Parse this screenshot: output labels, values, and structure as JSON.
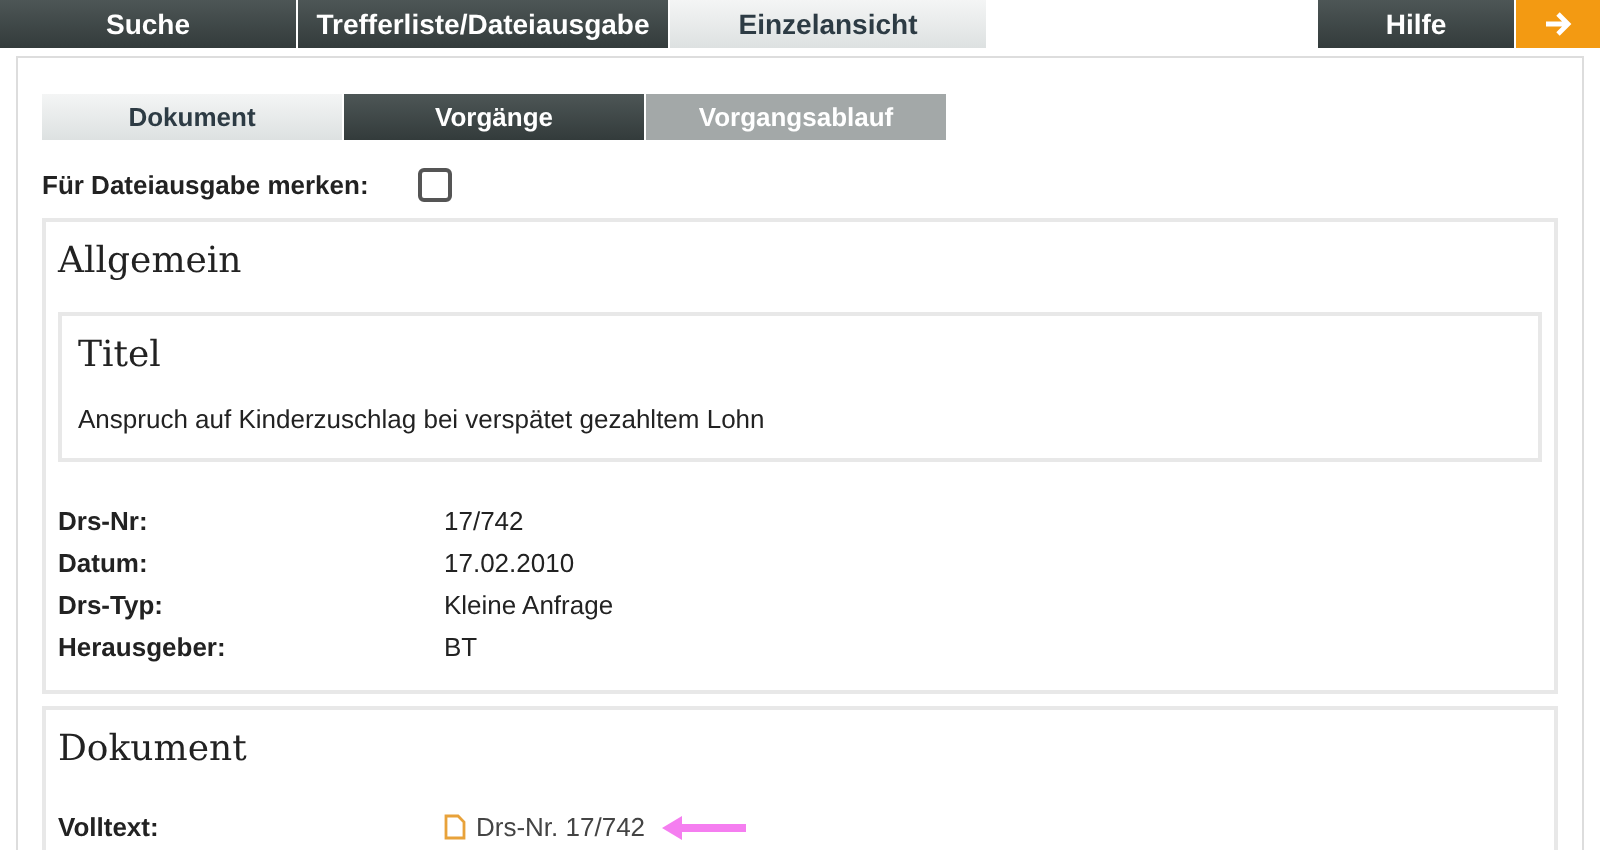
{
  "top_tabs": [
    {
      "label": "Suche",
      "selected": false
    },
    {
      "label": "Trefferliste/Dateiausgabe",
      "selected": false
    },
    {
      "label": "Einzelansicht",
      "selected": true
    }
  ],
  "help": {
    "label": "Hilfe"
  },
  "sub_tabs": [
    {
      "label": "Dokument",
      "selected": true,
      "disabled": false
    },
    {
      "label": "Vorgänge",
      "selected": false,
      "disabled": false
    },
    {
      "label": "Vorgangsablauf",
      "selected": false,
      "disabled": true
    }
  ],
  "remember": {
    "label": "Für Dateiausgabe merken:",
    "checked": false
  },
  "general": {
    "heading": "Allgemein",
    "title_heading": "Titel",
    "title": "Anspruch auf Kinderzuschlag bei verspätet gezahltem Lohn",
    "fields": [
      {
        "label": "Drs-Nr:",
        "value": "17/742"
      },
      {
        "label": "Datum:",
        "value": "17.02.2010"
      },
      {
        "label": "Drs-Typ:",
        "value": "Kleine Anfrage"
      },
      {
        "label": "Herausgeber:",
        "value": "BT"
      }
    ]
  },
  "document": {
    "heading": "Dokument",
    "label": "Volltext:",
    "link": "Drs-Nr. 17/742"
  }
}
